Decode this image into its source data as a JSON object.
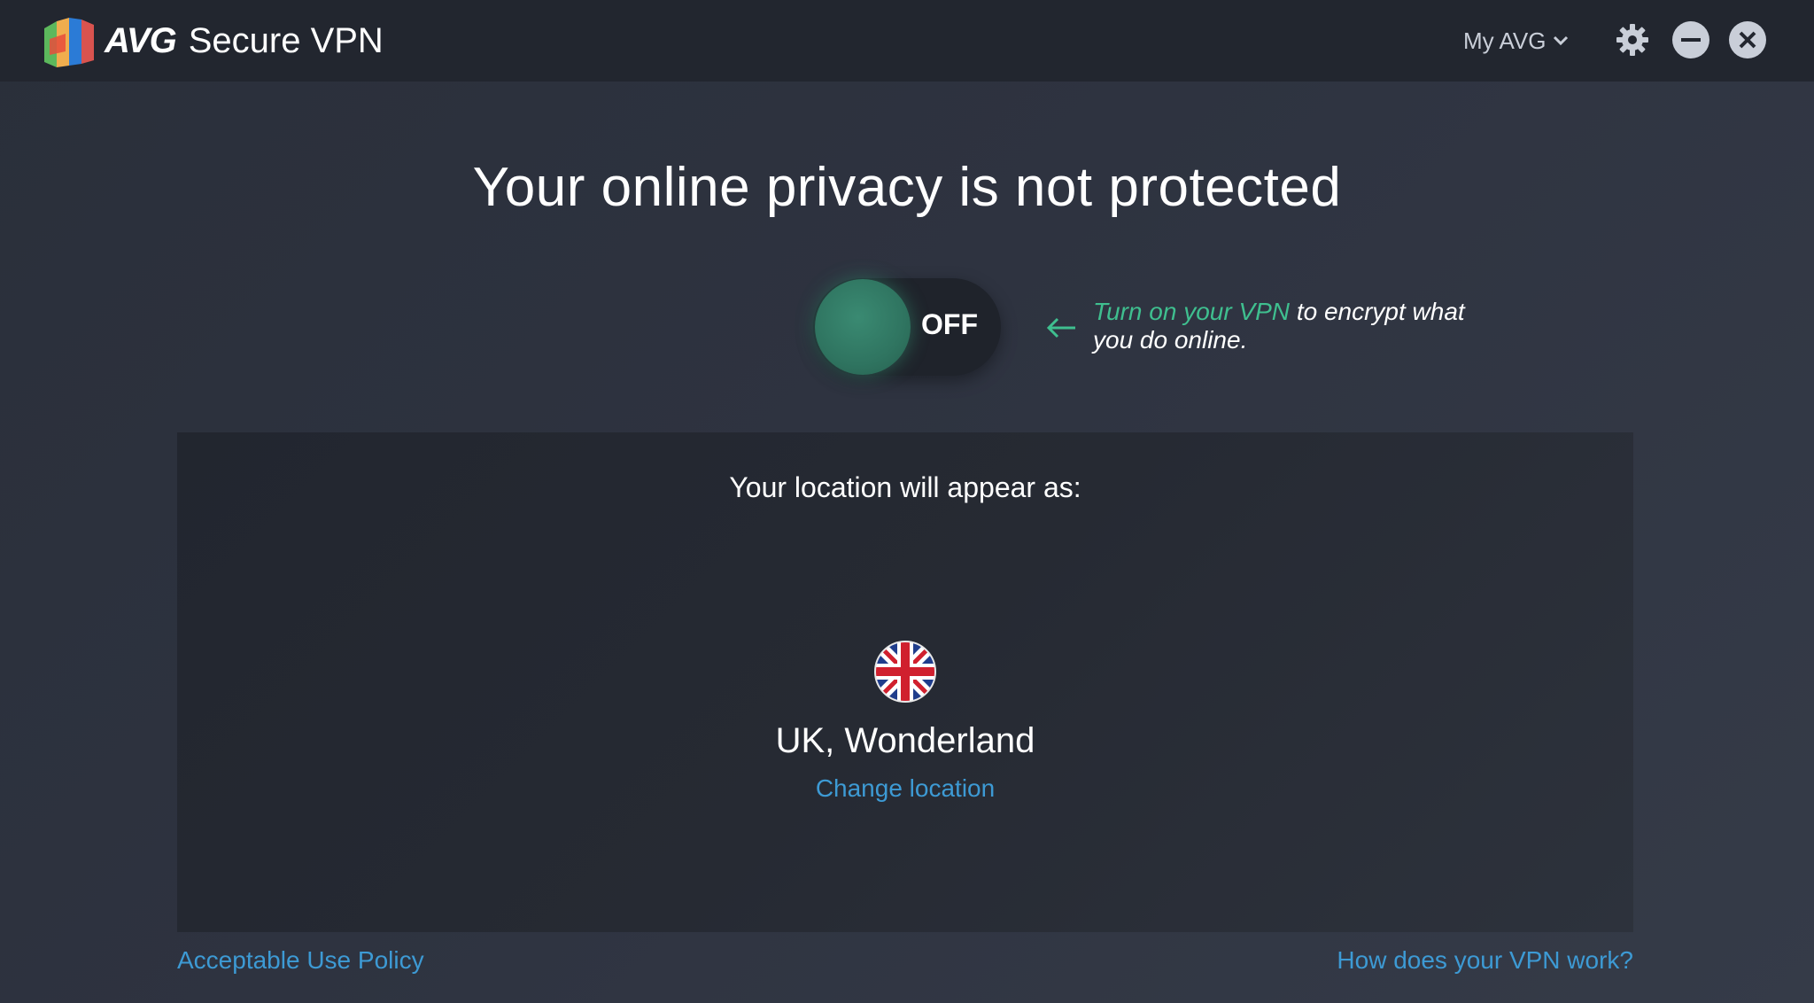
{
  "app": {
    "brand": "AVG",
    "product": "Secure VPN",
    "my_avg": "My AVG",
    "icons": [
      "avg-logo-icon",
      "chevron-down-icon",
      "gear-icon",
      "minimize-icon",
      "close-icon",
      "arrow-left-icon",
      "uk-flag-icon"
    ]
  },
  "status": {
    "headline": "Your online privacy is not protected",
    "toggle_state": "OFF",
    "hint_accent": "Turn on your VPN",
    "hint_rest": "to encrypt what you do online."
  },
  "location": {
    "label": "Your location will appear as:",
    "value": "UK, Wonderland",
    "change_link": "Change location"
  },
  "footer": {
    "policy_link": "Acceptable Use Policy",
    "help_link": "How does your VPN work?"
  },
  "colors": {
    "accent_green": "#3fbf8f",
    "link_blue": "#3d9ad4",
    "titlebar": "#22262f",
    "background": "#2e3340"
  }
}
